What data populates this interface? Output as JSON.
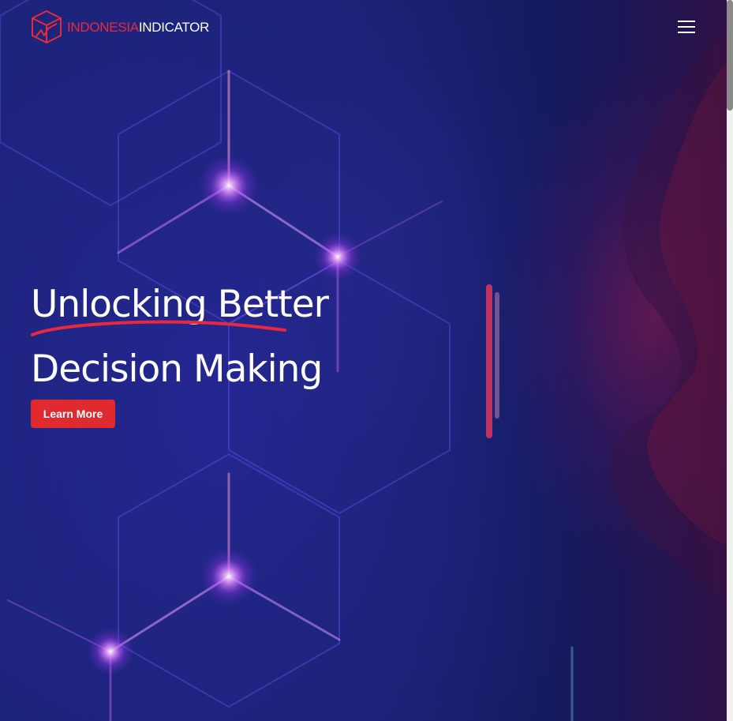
{
  "brand": {
    "name_part1": "INDONESIA",
    "name_part2": "INDICATOR",
    "logo_icon": "cube-chart-icon",
    "accent_color": "#e62b3b"
  },
  "navbar": {
    "menu_icon": "hamburger-menu-icon"
  },
  "hero": {
    "headline_line1": "Unlocking Better",
    "headline_line2": "Decision Making",
    "cta_label": "Learn More",
    "cta_color": "#df2a2f",
    "background_color": "#19216e"
  }
}
